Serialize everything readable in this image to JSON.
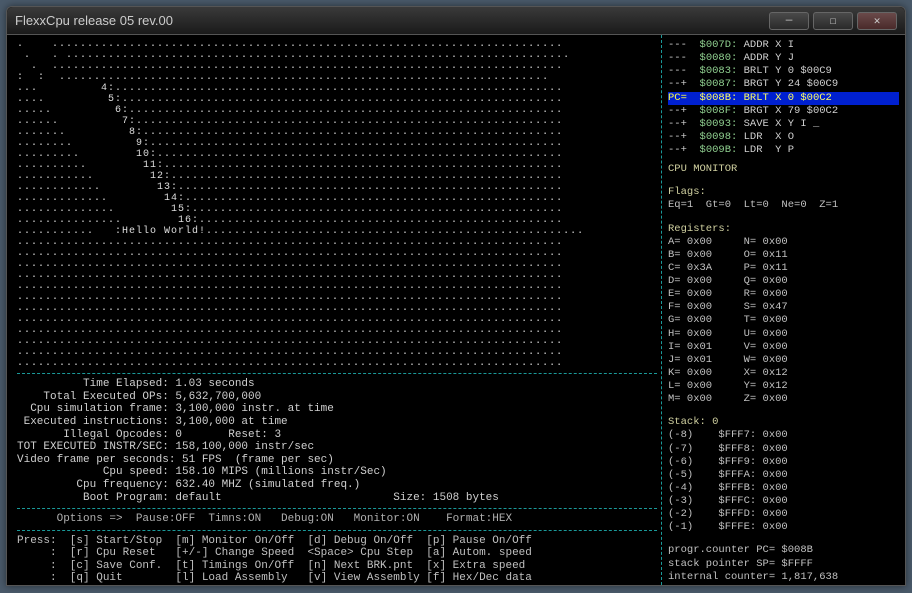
{
  "window": {
    "title": "FlexxCpu release 05 rev.00",
    "min": "—",
    "max": "☐",
    "close": "✕"
  },
  "disasm": [
    {
      "pre": "---  ",
      "addr": "$007D:",
      "txt": " ADDR X I"
    },
    {
      "pre": "---  ",
      "addr": "$0080:",
      "txt": " ADDR Y J"
    },
    {
      "pre": "---  ",
      "addr": "$0083:",
      "txt": " BRLT Y 0 $00C9"
    },
    {
      "pre": "--+  ",
      "addr": "$0087:",
      "txt": " BRGT Y 24 $00C9"
    },
    {
      "pre": "PC=  ",
      "addr": "$008B:",
      "txt": " BRLT X 0 $00C2",
      "hl": true
    },
    {
      "pre": "--+  ",
      "addr": "$008F:",
      "txt": " BRGT X 79 $00C2"
    },
    {
      "pre": "--+  ",
      "addr": "$0093:",
      "txt": " SAVE X Y I _"
    },
    {
      "pre": "--+  ",
      "addr": "$0098:",
      "txt": " LDR  X O"
    },
    {
      "pre": "--+  ",
      "addr": "$009B:",
      "txt": " LDR  Y P"
    }
  ],
  "monitor": {
    "title": "CPU MONITOR",
    "flags_label": "Flags:",
    "flags": "Eq=1  Gt=0  Lt=0  Ne=0  Z=1",
    "registers_label": "Registers:",
    "registers": [
      [
        "A= 0x00",
        "N= 0x00"
      ],
      [
        "B= 0x00",
        "O= 0x11"
      ],
      [
        "C= 0x3A",
        "P= 0x11"
      ],
      [
        "D= 0x00",
        "Q= 0x00"
      ],
      [
        "E= 0x00",
        "R= 0x00"
      ],
      [
        "F= 0x00",
        "S= 0x47"
      ],
      [
        "G= 0x00",
        "T= 0x00"
      ],
      [
        "H= 0x00",
        "U= 0x00"
      ],
      [
        "I= 0x01",
        "V= 0x00"
      ],
      [
        "J= 0x01",
        "W= 0x00"
      ],
      [
        "K= 0x00",
        "X= 0x12"
      ],
      [
        "L= 0x00",
        "Y= 0x12"
      ],
      [
        "M= 0x00",
        "Z= 0x00"
      ]
    ],
    "stack_label": "Stack: 0",
    "stack": [
      "(-8)    $FFF7: 0x00",
      "(-7)    $FFF8: 0x00",
      "(-6)    $FFF9: 0x00",
      "(-5)    $FFFA: 0x00",
      "(-4)    $FFFB: 0x00",
      "(-3)    $FFFC: 0x00",
      "(-2)    $FFFD: 0x00",
      "(-1)    $FFFE: 0x00"
    ],
    "pc": "progr.counter PC= $008B",
    "sp": "stack pointer SP= $FFFF",
    "ic": "internal counter= 1,817,638"
  },
  "stats": {
    "lines": [
      "          Time Elapsed: 1.03 seconds",
      "    Total Executed OPs: 5,632,700,000",
      "  Cpu simulation frame: 3,100,000 instr. at time",
      " Executed instructions: 3,100,000 at time",
      "       Illegal Opcodes: 0       Reset: 3",
      "TOT EXECUTED INSTR/SEC: 158,100,000 instr/sec",
      "Video frame per seconds: 51 FPS  (frame per sec)",
      "             Cpu speed: 158.10 MIPS (millions instr/Sec)",
      "         Cpu frequency: 632.40 MHZ (simulated freq.)",
      "          Boot Program: default                          Size: 1508 bytes"
    ]
  },
  "options": "      Options =>  Pause:OFF  Timns:ON   Debug:ON   Monitor:ON    Format:HEX",
  "keys": [
    "Press:  [s] Start/Stop  [m] Monitor On/Off  [d] Debug On/Off  [p] Pause On/Off",
    "     :  [r] Cpu Reset   [+/-] Change Speed  <Space> Cpu Step  [a] Autom. speed",
    "     :  [c] Save Conf.  [t] Timings On/Off  [n] Next BRK.pnt  [x] Extra speed",
    "     :  [q] Quit        [l] Load Assembly   [v] View Assembly [f] Hex/Dec data"
  ],
  "grid": {
    "numbers": [
      "4:",
      "5:",
      "6:",
      "7:",
      "8:",
      "9:",
      "10:",
      "11:",
      "12:",
      "13:",
      "14:",
      "15:",
      "16:"
    ],
    "hello": ":Hello World!"
  }
}
